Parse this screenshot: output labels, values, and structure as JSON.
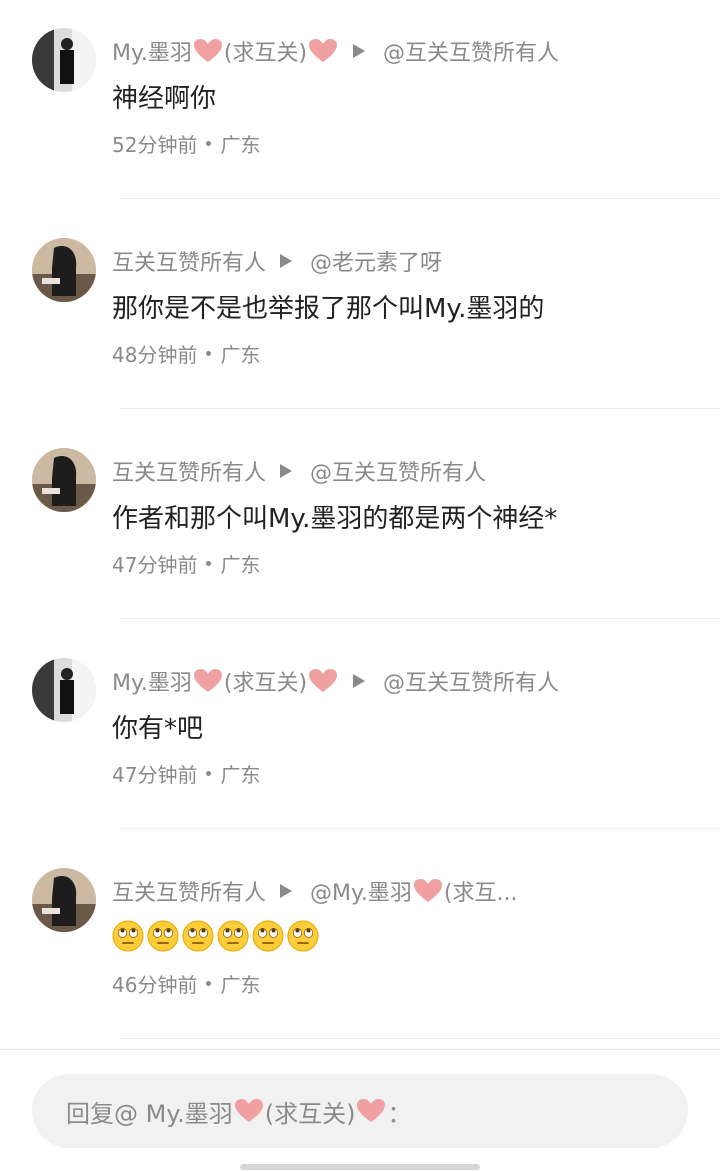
{
  "comments": [
    {
      "avatar": "avatar-photo-a",
      "author": "My.墨羽",
      "author_heart1": "heart",
      "author_suffix": "(求互关)",
      "author_heart2": "heart",
      "reply_to": "@互关互赞所有人",
      "text": "神经啊你",
      "time": "52分钟前",
      "location": "广东"
    },
    {
      "avatar": "avatar-photo-b",
      "author": "互关互赞所有人",
      "reply_to": "@老元素了呀",
      "text": "那你是不是也举报了那个叫My.墨羽的",
      "time": "48分钟前",
      "location": "广东"
    },
    {
      "avatar": "avatar-photo-b",
      "author": "互关互赞所有人",
      "reply_to": "@互关互赞所有人",
      "text": "作者和那个叫My.墨羽的都是两个神经*",
      "time": "47分钟前",
      "location": "广东"
    },
    {
      "avatar": "avatar-photo-a",
      "author": "My.墨羽",
      "author_suffix": "(求互关)",
      "reply_to": "@互关互赞所有人",
      "text": "你有*吧",
      "time": "47分钟前",
      "location": "广东"
    },
    {
      "avatar": "avatar-photo-b",
      "author": "互关互赞所有人",
      "reply_to_prefix": "@My.墨羽",
      "reply_to_suffix": "(求互...",
      "emojis": [
        "eye-roll-emoji",
        "eye-roll-emoji",
        "eye-roll-emoji",
        "eye-roll-emoji",
        "eye-roll-emoji",
        "eye-roll-emoji"
      ],
      "time": "46分钟前",
      "location": "广东"
    }
  ],
  "reply_box": {
    "prefix": "回复@ My.墨羽",
    "middle": "(求互关)",
    "suffix": "："
  },
  "colors": {
    "heart": "#f0a0a0",
    "meta_text": "#8a8a8a",
    "body_text": "#222222",
    "reply_box_bg": "#f1f1f1"
  }
}
